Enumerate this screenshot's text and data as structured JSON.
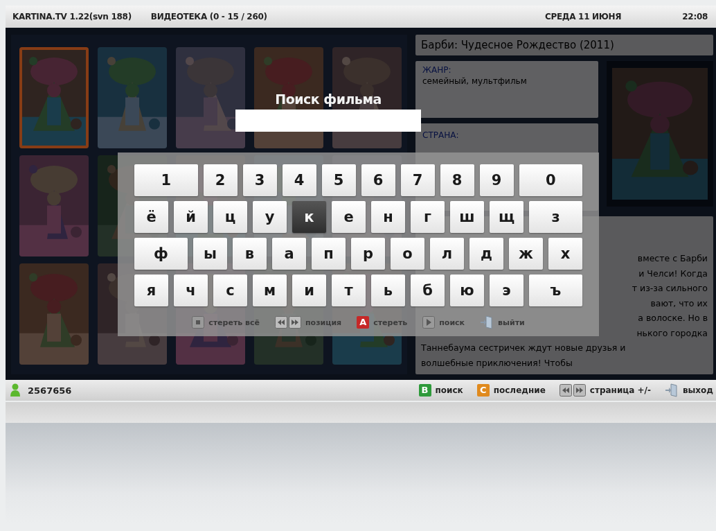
{
  "header": {
    "app": "KARTINA.TV 1.22(svn 188)",
    "section": "ВИДЕОТЕКА (0 - 15 / 260)",
    "date": "СРЕДА 11 ИЮНЯ",
    "time": "22:08"
  },
  "posters": [
    {
      "kind": "picture",
      "selected": true
    },
    {
      "kind": "picture",
      "selected": false
    },
    {
      "kind": "picture",
      "selected": false
    },
    {
      "kind": "picture",
      "selected": false
    },
    {
      "kind": "picture",
      "selected": false
    },
    {
      "kind": "picture",
      "selected": false
    },
    {
      "kind": "picture",
      "selected": false
    },
    {
      "kind": "picture",
      "selected": false
    },
    {
      "kind": "picture",
      "selected": false
    },
    {
      "kind": "picture",
      "selected": false
    },
    {
      "kind": "picture",
      "selected": false
    },
    {
      "kind": "picture",
      "selected": false
    },
    {
      "kind": "picture",
      "selected": false
    },
    {
      "kind": "picture",
      "selected": false
    },
    {
      "kind": "picture",
      "selected": false
    }
  ],
  "details": {
    "title": "Барби: Чудесное Рождество (2011)",
    "genre_label": "ЖАНР:",
    "genre": "семейный, мультфильм",
    "country_label": "СТРАНА:",
    "poster": {
      "kind": "picture"
    },
    "description_fragments": [
      "вместе с Барби",
      "и Челси! Когда",
      "т из-за сильного",
      "вают, что их",
      "а волоске. Но в",
      "нького городка"
    ],
    "description_lines": [
      "Таннебаума сестричек ждут новые друзья и",
      "волшебные приключения! Чтобы"
    ]
  },
  "search": {
    "title": "Поиск фильма"
  },
  "keyboard": {
    "rows": [
      {
        "keys": [
          {
            "label": "1",
            "wide": true,
            "selected": false
          },
          {
            "label": "2",
            "wide": false,
            "selected": false
          },
          {
            "label": "3",
            "wide": false,
            "selected": false
          },
          {
            "label": "4",
            "wide": false,
            "selected": false
          },
          {
            "label": "5",
            "wide": false,
            "selected": false
          },
          {
            "label": "6",
            "wide": false,
            "selected": false
          },
          {
            "label": "7",
            "wide": false,
            "selected": false
          },
          {
            "label": "8",
            "wide": false,
            "selected": false
          },
          {
            "label": "9",
            "wide": false,
            "selected": false
          },
          {
            "label": "0",
            "wide": true,
            "selected": false
          }
        ]
      },
      {
        "keys": [
          {
            "label": "ё",
            "wide": false,
            "selected": false
          },
          {
            "label": "й",
            "wide": false,
            "selected": false
          },
          {
            "label": "ц",
            "wide": false,
            "selected": false
          },
          {
            "label": "у",
            "wide": false,
            "selected": false
          },
          {
            "label": "к",
            "wide": false,
            "selected": true
          },
          {
            "label": "е",
            "wide": false,
            "selected": false
          },
          {
            "label": "н",
            "wide": false,
            "selected": false
          },
          {
            "label": "г",
            "wide": false,
            "selected": false
          },
          {
            "label": "ш",
            "wide": false,
            "selected": false
          },
          {
            "label": "щ",
            "wide": false,
            "selected": false
          },
          {
            "label": "з",
            "wide": true,
            "selected": false
          }
        ]
      },
      {
        "keys": [
          {
            "label": "ф",
            "wide": true,
            "selected": false
          },
          {
            "label": "ы",
            "wide": false,
            "selected": false
          },
          {
            "label": "в",
            "wide": false,
            "selected": false
          },
          {
            "label": "а",
            "wide": false,
            "selected": false
          },
          {
            "label": "п",
            "wide": false,
            "selected": false
          },
          {
            "label": "р",
            "wide": false,
            "selected": false
          },
          {
            "label": "о",
            "wide": false,
            "selected": false
          },
          {
            "label": "л",
            "wide": false,
            "selected": false
          },
          {
            "label": "д",
            "wide": false,
            "selected": false
          },
          {
            "label": "ж",
            "wide": false,
            "selected": false
          },
          {
            "label": "х",
            "wide": false,
            "selected": false
          }
        ]
      },
      {
        "keys": [
          {
            "label": "я",
            "wide": false,
            "selected": false
          },
          {
            "label": "ч",
            "wide": false,
            "selected": false
          },
          {
            "label": "с",
            "wide": false,
            "selected": false
          },
          {
            "label": "м",
            "wide": false,
            "selected": false
          },
          {
            "label": "и",
            "wide": false,
            "selected": false
          },
          {
            "label": "т",
            "wide": false,
            "selected": false
          },
          {
            "label": "ь",
            "wide": false,
            "selected": false
          },
          {
            "label": "б",
            "wide": false,
            "selected": false
          },
          {
            "label": "ю",
            "wide": false,
            "selected": false
          },
          {
            "label": "э",
            "wide": false,
            "selected": false
          },
          {
            "label": "ъ",
            "wide": true,
            "selected": false
          }
        ]
      }
    ],
    "hints": [
      {
        "kind": "stop",
        "label": "стереть всё"
      },
      {
        "kind": "seek",
        "label": "позиция"
      },
      {
        "kind": "color",
        "key": "A",
        "color": "#c62828",
        "label": "стереть"
      },
      {
        "kind": "play",
        "label": "поиск"
      },
      {
        "kind": "exit",
        "label": "выйти"
      }
    ]
  },
  "status_bar": {
    "user": "2567656",
    "hints": [
      {
        "kind": "color",
        "key": "B",
        "color": "#2e9a3a",
        "label": "поиск"
      },
      {
        "kind": "color",
        "key": "C",
        "color": "#e08a1e",
        "label": "последние"
      },
      {
        "kind": "seek",
        "label": "страница +/-"
      },
      {
        "kind": "exit",
        "label": "выход"
      }
    ]
  }
}
